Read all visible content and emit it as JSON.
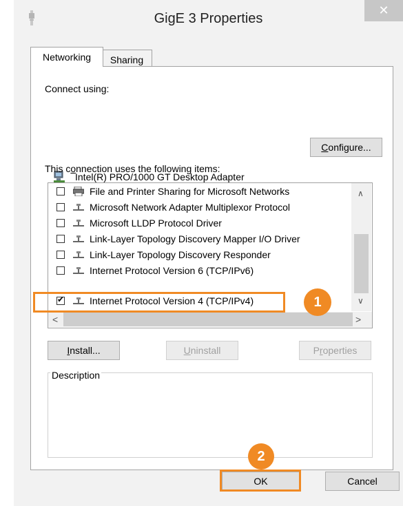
{
  "window": {
    "title": "GigE 3 Properties",
    "close_glyph": "✕"
  },
  "tabs": [
    {
      "label": "Networking",
      "active": true
    },
    {
      "label": "Sharing",
      "active": false
    }
  ],
  "networking": {
    "connect_using_label": "Connect using:",
    "adapter_name": "Intel(R) PRO/1000 GT Desktop Adapter",
    "configure_button": {
      "prefix": "",
      "mnemonic": "C",
      "rest": "onfigure..."
    },
    "items_label": {
      "prefix": "This c",
      "mnemonic": "o",
      "rest": "nnection uses the following items:"
    },
    "items": [
      {
        "label": "File and Printer Sharing for Microsoft Networks",
        "checked": false,
        "icon": "printer-icon"
      },
      {
        "label": "Microsoft Network Adapter Multiplexor Protocol",
        "checked": false,
        "icon": "network-protocol-icon"
      },
      {
        "label": "Microsoft LLDP Protocol Driver",
        "checked": false,
        "icon": "network-protocol-icon"
      },
      {
        "label": "Link-Layer Topology Discovery Mapper I/O Driver",
        "checked": false,
        "icon": "network-protocol-icon"
      },
      {
        "label": "Link-Layer Topology Discovery Responder",
        "checked": false,
        "icon": "network-protocol-icon"
      },
      {
        "label": "Internet Protocol Version 6 (TCP/IPv6)",
        "checked": false,
        "icon": "network-protocol-icon"
      },
      {
        "label": "Internet Protocol Version 4 (TCP/IPv4)",
        "checked": true,
        "icon": "network-protocol-icon"
      }
    ],
    "install_button": {
      "prefix": "",
      "mnemonic": "I",
      "rest": "nstall..."
    },
    "uninstall_button": {
      "prefix": "",
      "mnemonic": "U",
      "rest": "ninstall"
    },
    "properties_button": {
      "prefix": "P",
      "mnemonic": "r",
      "rest": "operties"
    },
    "description_label": "Description"
  },
  "footer": {
    "ok_button": "OK",
    "cancel_button": "Cancel"
  },
  "annotations": {
    "step1": "1",
    "step2": "2",
    "highlight_color": "#f08a24"
  }
}
